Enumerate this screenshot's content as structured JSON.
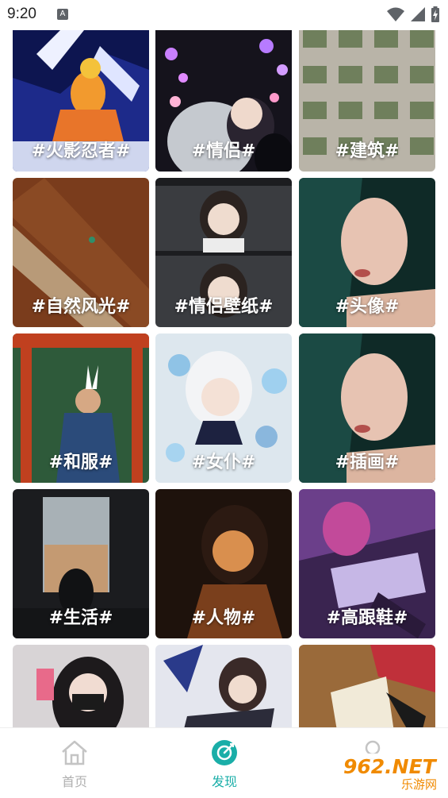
{
  "status_bar": {
    "time": "9:20",
    "notification_badge": "A"
  },
  "tags": [
    {
      "label": "#火影忍者#"
    },
    {
      "label": "#情侣#"
    },
    {
      "label": "#建筑#"
    },
    {
      "label": "#自然风光#"
    },
    {
      "label": "#情侣壁纸#"
    },
    {
      "label": "#头像#"
    },
    {
      "label": "#和服#"
    },
    {
      "label": "#女仆#"
    },
    {
      "label": "#插画#"
    },
    {
      "label": "#生活#"
    },
    {
      "label": "#人物#"
    },
    {
      "label": "#高跟鞋#"
    },
    {
      "label": ""
    },
    {
      "label": ""
    },
    {
      "label": ""
    }
  ],
  "bottom_nav": {
    "home": "首页",
    "discover": "发现",
    "mine": ""
  },
  "watermark": {
    "logo": "962.NET",
    "text": "乐游网"
  },
  "colors": {
    "accent": "#1aaea8",
    "inactive": "#b0b0b0"
  }
}
